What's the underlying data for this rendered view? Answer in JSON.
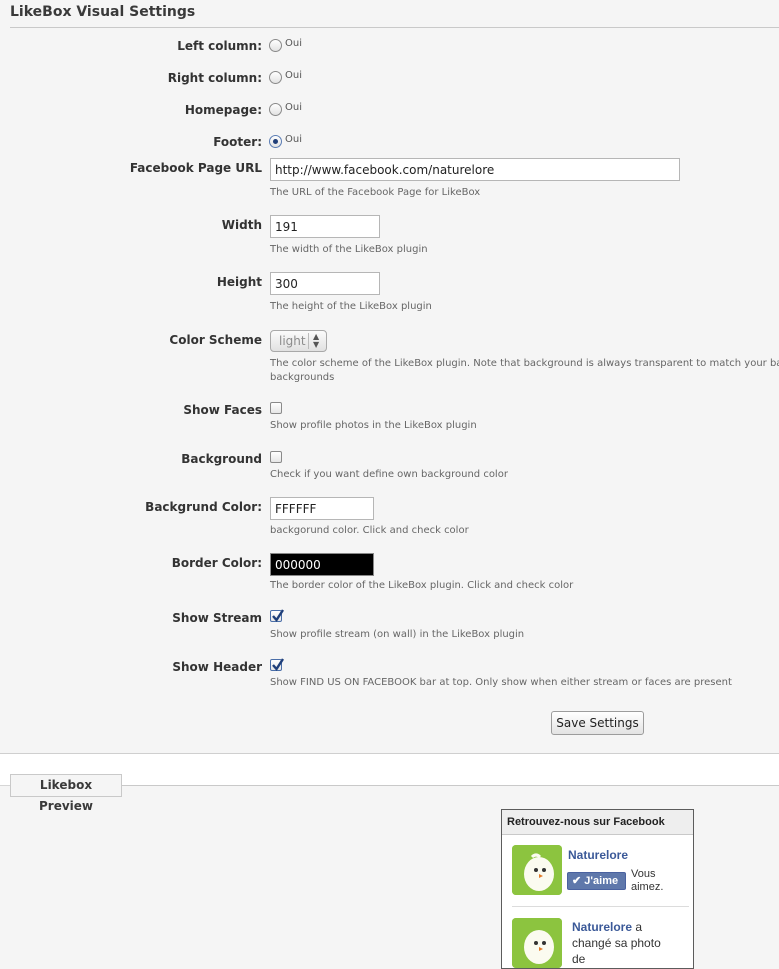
{
  "header": {
    "title": "LikeBox Visual Settings"
  },
  "positions": [
    {
      "label": "Left column:",
      "option": "Oui",
      "checked": false
    },
    {
      "label": "Right column:",
      "option": "Oui",
      "checked": false
    },
    {
      "label": "Homepage:",
      "option": "Oui",
      "checked": false
    },
    {
      "label": "Footer:",
      "option": "Oui",
      "checked": true
    }
  ],
  "fields": {
    "facebook_url": {
      "label": "Facebook Page URL",
      "value": "http://www.facebook.com/naturelore",
      "help": "The URL of the Facebook Page for LikeBox"
    },
    "width": {
      "label": "Width",
      "value": "191",
      "help": "The width of the LikeBox plugin"
    },
    "height": {
      "label": "Height",
      "value": "300",
      "help": "The height of the LikeBox plugin"
    },
    "color_scheme": {
      "label": "Color Scheme",
      "value": "light",
      "help_line1": "The color scheme of the LikeBox plugin. Note that background is always transparent to match your backgr",
      "help_line2": "backgrounds"
    },
    "show_faces": {
      "label": "Show Faces",
      "checked": false,
      "help": "Show profile photos in the LikeBox plugin"
    },
    "background": {
      "label": "Background",
      "checked": false,
      "help": "Check if you want define own background color"
    },
    "background_color": {
      "label": "Backgrund Color:",
      "value": "FFFFFF",
      "help": "backgorund color. Click and check color"
    },
    "border_color": {
      "label": "Border Color:",
      "value": "000000",
      "help": "The border color of the LikeBox plugin. Click and check color"
    },
    "show_stream": {
      "label": "Show Stream",
      "checked": true,
      "help": "Show profile stream (on wall) in the LikeBox plugin"
    },
    "show_header": {
      "label": "Show Header",
      "checked": true,
      "help": "Show FIND US ON FACEBOOK bar at top. Only show when either stream or faces are present"
    }
  },
  "actions": {
    "save_label": "Save Settings"
  },
  "preview": {
    "tab_label": "Likebox Preview",
    "header": "Retrouvez-nous sur Facebook",
    "page_name": "Naturelore",
    "like_label": "J'aime",
    "like_note": "Vous aimez.",
    "story_name": "Naturelore",
    "story_text": "a changé sa photo de",
    "avatar_color": "#8cc43f",
    "accent": "#3b5998"
  }
}
